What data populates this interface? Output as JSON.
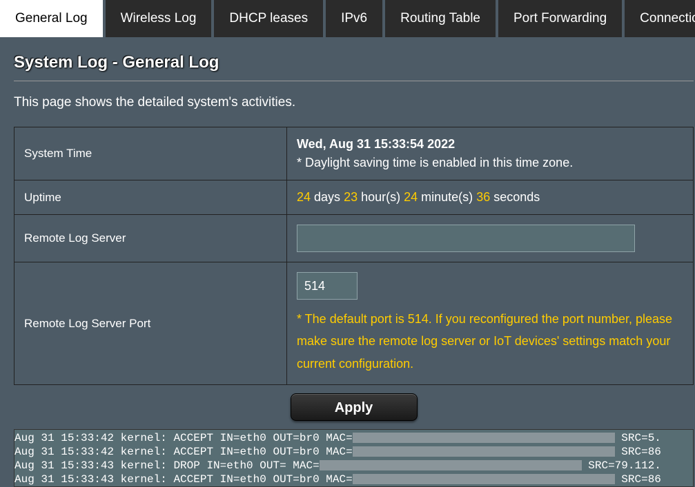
{
  "tabs": [
    {
      "label": "General Log",
      "active": true
    },
    {
      "label": "Wireless Log",
      "active": false
    },
    {
      "label": "DHCP leases",
      "active": false
    },
    {
      "label": "IPv6",
      "active": false
    },
    {
      "label": "Routing Table",
      "active": false
    },
    {
      "label": "Port Forwarding",
      "active": false
    },
    {
      "label": "Connections",
      "active": false
    }
  ],
  "page_title": "System Log - General Log",
  "description": "This page shows the detailed system's activities.",
  "rows": {
    "system_time": {
      "label": "System Time",
      "value": "Wed, Aug 31 15:33:54 2022",
      "note": "* Daylight saving time is enabled in this time zone."
    },
    "uptime": {
      "label": "Uptime",
      "days": "24",
      "days_unit": " days ",
      "hours": "23",
      "hours_unit": " hour(s) ",
      "minutes": "24",
      "minutes_unit": " minute(s) ",
      "seconds": "36",
      "seconds_unit": " seconds"
    },
    "remote_server": {
      "label": "Remote Log Server",
      "value": ""
    },
    "remote_port": {
      "label": "Remote Log Server Port",
      "value": "514",
      "note": "* The default port is 514. If you reconfigured the port number, please make sure the remote log server or IoT devices' settings match your current configuration."
    }
  },
  "apply_label": "Apply",
  "log_lines": [
    {
      "prefix": "Aug 31 15:33:42 kernel: ACCEPT IN=eth0 OUT=br0 MAC=",
      "redact_w": 380,
      "suffix": " SRC=5."
    },
    {
      "prefix": "Aug 31 15:33:42 kernel: ACCEPT IN=eth0 OUT=br0 MAC=",
      "redact_w": 380,
      "suffix": " SRC=86"
    },
    {
      "prefix": "Aug 31 15:33:43 kernel: DROP IN=eth0 OUT= MAC=",
      "redact_w": 380,
      "suffix": " SRC=79.112."
    },
    {
      "prefix": "Aug 31 15:33:43 kernel: ACCEPT IN=eth0 OUT=br0 MAC=",
      "redact_w": 380,
      "suffix": " SRC=86"
    }
  ]
}
